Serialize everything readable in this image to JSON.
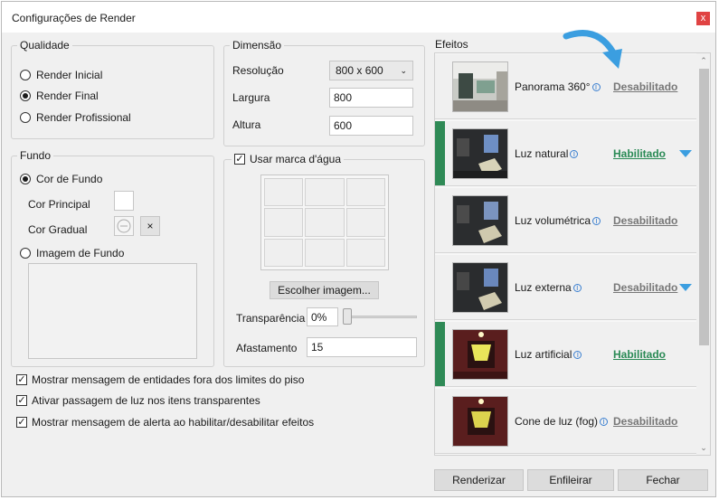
{
  "window": {
    "title": "Configurações de Render",
    "close_glyph": "x"
  },
  "qualidade": {
    "legend": "Qualidade",
    "options": [
      "Render Inicial",
      "Render Final",
      "Render Profissional"
    ],
    "selected": "Render Final"
  },
  "dimensao": {
    "legend": "Dimensão",
    "resolucao_label": "Resolução",
    "resolucao_value": "800 x 600",
    "largura_label": "Largura",
    "largura_value": "800",
    "altura_label": "Altura",
    "altura_value": "600"
  },
  "fundo": {
    "legend": "Fundo",
    "cor_de_fundo": "Cor de Fundo",
    "cor_principal": "Cor Principal",
    "cor_gradual": "Cor Gradual",
    "imagem_de_fundo": "Imagem de Fundo",
    "clear_glyph": "×"
  },
  "marca": {
    "legend": "Usar marca d'água",
    "checked": true,
    "choose_button": "Escolher imagem...",
    "transparencia_label": "Transparência",
    "transparencia_value": "0%",
    "transparencia_level": 0,
    "afastamento_label": "Afastamento",
    "afastamento_value": "15"
  },
  "options": [
    {
      "label": "Mostrar mensagem de entidades fora dos limites do piso",
      "checked": true
    },
    {
      "label": "Ativar passagem de luz nos itens transparentes",
      "checked": true
    },
    {
      "label": "Mostrar mensagem de alerta ao habilitar/desabilitar efeitos",
      "checked": true
    }
  ],
  "check_glyph": "✓",
  "info_glyph": "i",
  "effects": {
    "label": "Efeitos",
    "items": [
      {
        "name": "Panorama 360°",
        "status": "Desabilitado",
        "enabled": false,
        "expandable": false
      },
      {
        "name": "Luz natural",
        "status": "Habilitado",
        "enabled": true,
        "expandable": true
      },
      {
        "name": "Luz volumétrica",
        "status": "Desabilitado",
        "enabled": false,
        "expandable": false
      },
      {
        "name": "Luz externa",
        "status": "Desabilitado",
        "enabled": false,
        "expandable": true
      },
      {
        "name": "Luz artificial",
        "status": "Habilitado",
        "enabled": true,
        "expandable": false
      },
      {
        "name": "Cone de luz (fog)",
        "status": "Desabilitado",
        "enabled": false,
        "expandable": false
      }
    ]
  },
  "buttons": {
    "renderizar": "Renderizar",
    "enfileirar": "Enfileirar",
    "fechar": "Fechar"
  },
  "colors": {
    "enabled_bar": "#2f8a56",
    "enabled_text": "#2a8a55",
    "arrow": "#3b9ee0"
  }
}
